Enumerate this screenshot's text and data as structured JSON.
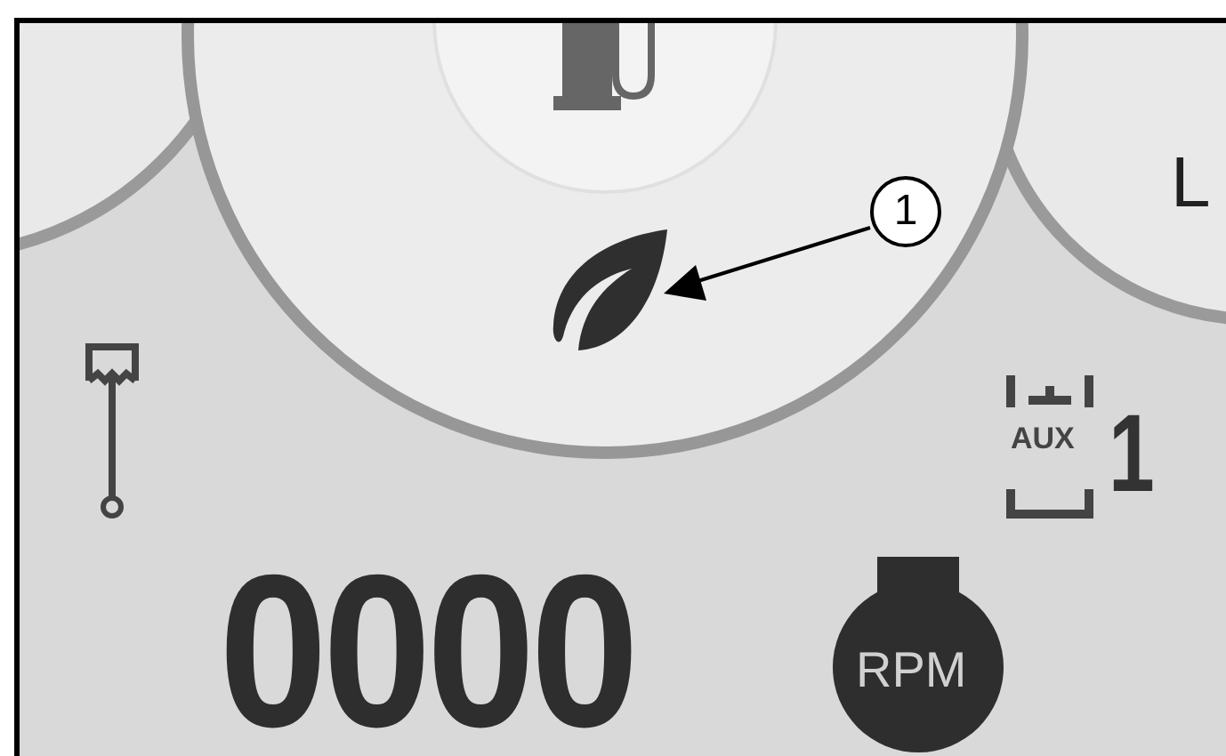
{
  "callout": {
    "number": "1"
  },
  "side_gauge_right": {
    "label": "L"
  },
  "aux_indicator": {
    "label": "AUX",
    "number": "1"
  },
  "engine_speed": {
    "value": "0000",
    "unit": "RPM"
  }
}
